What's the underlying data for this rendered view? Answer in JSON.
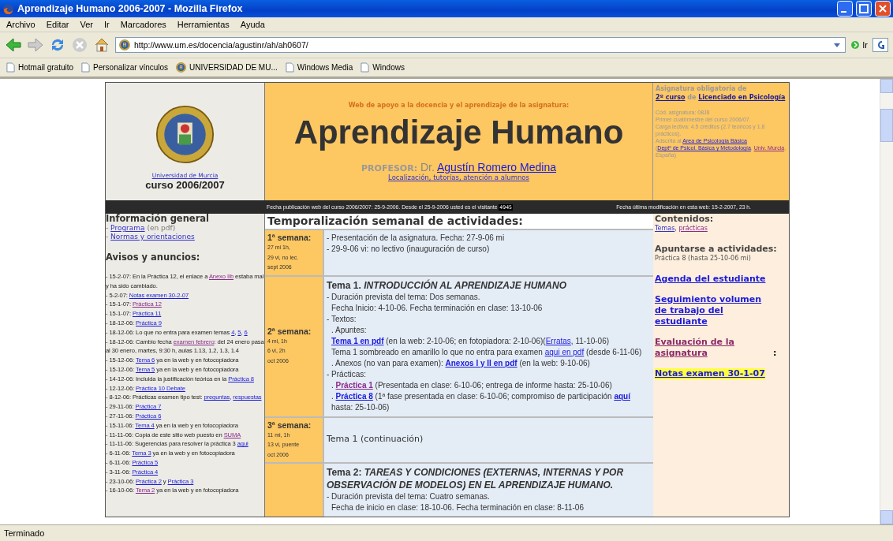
{
  "window": {
    "title": "Aprendizaje Humano 2006-2007 - Mozilla Firefox"
  },
  "menu": [
    "Archivo",
    "Editar",
    "Ver",
    "Ir",
    "Marcadores",
    "Herramientas",
    "Ayuda"
  ],
  "toolbar": {
    "url": "http://www.um.es/docencia/agustinr/ah/ah0607/",
    "go": "Ir"
  },
  "bookmarks": [
    {
      "label": "Hotmail gratuito",
      "kind": "page"
    },
    {
      "label": "Personalizar vínculos",
      "kind": "page"
    },
    {
      "label": "UNIVERSIDAD DE MU...",
      "kind": "seal"
    },
    {
      "label": "Windows Media",
      "kind": "page"
    },
    {
      "label": "Windows",
      "kind": "page"
    }
  ],
  "header": {
    "university_link": "Universidad de Murcia",
    "course": "curso 2006/2007",
    "tagline": "Web de apoyo a la docencia y el aprendizaje de la asignatura:",
    "title": "Aprendizaje Humano",
    "professor": [
      {
        "text": "PROFESOR:",
        "kind": "label"
      },
      {
        "text": " Dr. ",
        "kind": "text"
      },
      {
        "text": "Agustín Romero Medina",
        "kind": "link"
      }
    ],
    "contact_link": "Localización, tutorías, atención a alumnos",
    "subject_lines": [
      [
        {
          "text": "Asignatura obligatoria de",
          "kind": "text"
        }
      ],
      [
        {
          "text": "2º curso",
          "kind": "link"
        },
        {
          "text": " de ",
          "kind": "text"
        },
        {
          "text": "Licenciado en Psicología",
          "kind": "link"
        }
      ]
    ],
    "details": [
      [
        {
          "text": "Cód. asignatura: 08J8",
          "kind": "text"
        }
      ],
      [
        {
          "text": "Primer cuatrimestre del curso 2006/07.",
          "kind": "text"
        }
      ],
      [
        {
          "text": "Carga lectiva: 4.5 créditos (2.7 teóricos y 1.8 prácticos).",
          "kind": "text"
        }
      ],
      [
        {
          "text": "Adscrita al ",
          "kind": "text"
        },
        {
          "text": "Area de Psicología Básica",
          "kind": "link"
        }
      ],
      [
        {
          "text": "(",
          "kind": "text"
        },
        {
          "text": "Deptº de Psicol. Básica y Metodología",
          "kind": "link"
        },
        {
          "text": ", ",
          "kind": "text"
        },
        {
          "text": "Univ. Murcia",
          "kind": "visited"
        },
        {
          "text": ", España)",
          "kind": "text"
        }
      ]
    ]
  },
  "info_bar": {
    "left": [
      {
        "text": "Fecha publicación web del curso 2006/2007: 25-9-2006. Desde el 25-9-2006 usted es el visitante ",
        "kind": "text"
      },
      {
        "text": "4945",
        "kind": "counter"
      }
    ],
    "right": "Fecha última modificación en esta web: 15-2-2007, 23 h."
  },
  "left": {
    "heading": "Información general",
    "links": [
      [
        {
          "text": "- ",
          "kind": "text"
        },
        {
          "text": "Programa",
          "kind": "link"
        },
        {
          "text": " (en pdf)",
          "kind": "text"
        }
      ],
      [
        {
          "text": "- ",
          "kind": "text"
        },
        {
          "text": "Normas y orientaciones",
          "kind": "link"
        }
      ]
    ],
    "news_heading": "Avisos y anuncios:",
    "news": [
      [
        {
          "text": "- 15-2-07: En la Práctica 12, el enlace a ",
          "kind": "text"
        },
        {
          "text": "Anexo IIb",
          "kind": "visited"
        },
        {
          "text": " estaba mal y ha sido cambiado.",
          "kind": "text"
        }
      ],
      [
        {
          "text": "- 5-2-07: ",
          "kind": "text"
        },
        {
          "text": "Notas examen 30-2-07",
          "kind": "link"
        }
      ],
      [
        {
          "text": "- 15-1-07: ",
          "kind": "text"
        },
        {
          "text": "Práctica 12",
          "kind": "visited"
        }
      ],
      [
        {
          "text": "- 15-1-07: ",
          "kind": "text"
        },
        {
          "text": "Práctica 11",
          "kind": "link"
        }
      ],
      [
        {
          "text": "- 18-12-06: ",
          "kind": "text"
        },
        {
          "text": "Práctica 9",
          "kind": "link"
        }
      ],
      [
        {
          "text": "- 18-12-06: Lo que no entra para examen temas ",
          "kind": "text"
        },
        {
          "text": "4",
          "kind": "link"
        },
        {
          "text": ", ",
          "kind": "text"
        },
        {
          "text": "5",
          "kind": "link"
        },
        {
          "text": ", ",
          "kind": "text"
        },
        {
          "text": "6",
          "kind": "link"
        }
      ],
      [
        {
          "text": "- 18-12-06: Cambio fecha ",
          "kind": "text"
        },
        {
          "text": "examen febrero",
          "kind": "visited"
        },
        {
          "text": ": del 24 enero pasa al 30 enero, martes, 9:30 h, aulas 1.13, 1.2, 1.3, 1.4",
          "kind": "text"
        }
      ],
      [
        {
          "text": "- 15-12-06: ",
          "kind": "text"
        },
        {
          "text": "Tema 6",
          "kind": "link"
        },
        {
          "text": " ya en la web y en fotocopiadora",
          "kind": "text"
        }
      ],
      [
        {
          "text": "- 15-12-06: ",
          "kind": "text"
        },
        {
          "text": "Tema 5",
          "kind": "link"
        },
        {
          "text": " ya en la web y en fotocopiadora",
          "kind": "text"
        }
      ],
      [
        {
          "text": "- 14-12-06: Incluida la justificación teórica en la ",
          "kind": "text"
        },
        {
          "text": "Práctica 8",
          "kind": "link"
        }
      ],
      [
        {
          "text": "- 12-12-06: ",
          "kind": "text"
        },
        {
          "text": "Práctica 10 Debate",
          "kind": "link"
        }
      ],
      [
        {
          "text": "- 8-12-06: Prácticas examen tipo test: ",
          "kind": "text"
        },
        {
          "text": "preguntas",
          "kind": "link"
        },
        {
          "text": ", ",
          "kind": "text"
        },
        {
          "text": "respuestas",
          "kind": "link"
        }
      ],
      [
        {
          "text": "- 29-11-06: ",
          "kind": "text"
        },
        {
          "text": "Práctica 7",
          "kind": "link"
        }
      ],
      [
        {
          "text": "- 27-11-06: ",
          "kind": "text"
        },
        {
          "text": "Práctica 6",
          "kind": "link"
        }
      ],
      [
        {
          "text": "- 15-11-06: ",
          "kind": "text"
        },
        {
          "text": "Tema 4",
          "kind": "link"
        },
        {
          "text": " ya en la web y en fotocopiadora",
          "kind": "text"
        }
      ],
      [
        {
          "text": "- 11-11-06: Copia de este sitio web puesto en ",
          "kind": "text"
        },
        {
          "text": "SUMA",
          "kind": "visited"
        }
      ],
      [
        {
          "text": "- 11-11-06: Sugerencias para resolver la práctica 3 ",
          "kind": "text"
        },
        {
          "text": "aqui",
          "kind": "link"
        }
      ],
      [
        {
          "text": "- 6-11-06: ",
          "kind": "text"
        },
        {
          "text": "Tema 3",
          "kind": "link"
        },
        {
          "text": " ya en la web y en fotocopiadora",
          "kind": "text"
        }
      ],
      [
        {
          "text": "- 6-11-06: ",
          "kind": "text"
        },
        {
          "text": "Práctica 5",
          "kind": "link"
        }
      ],
      [
        {
          "text": "- 3-11-06: ",
          "kind": "text"
        },
        {
          "text": "Práctica 4",
          "kind": "link"
        }
      ],
      [
        {
          "text": "- 23-10-06: ",
          "kind": "text"
        },
        {
          "text": "Práctica 2",
          "kind": "link"
        },
        {
          "text": " y ",
          "kind": "text"
        },
        {
          "text": "Práctica 3",
          "kind": "link"
        }
      ],
      [
        {
          "text": "- 16-10-06: ",
          "kind": "text"
        },
        {
          "text": "Tema 2",
          "kind": "visited"
        },
        {
          "text": " ya en la web y en fotocopiadora",
          "kind": "text"
        }
      ]
    ]
  },
  "schedule": {
    "heading": "Temporalización semanal de actividades:",
    "weeks": [
      {
        "label": "1ª semana:",
        "notes": [
          "27 mi 1h,",
          "29 vi, no lec.",
          "sept 2006"
        ],
        "lines": [
          {
            "kind": "line",
            "indent": false,
            "parts": [
              {
                "text": "- Presentación de la asignatura. Fecha: 27-9-06 mi",
                "kind": "text"
              }
            ]
          },
          {
            "kind": "line",
            "indent": false,
            "parts": [
              {
                "text": "- 29-9-06 vi: no lectivo (inauguración de curso)",
                "kind": "text"
              }
            ]
          }
        ]
      },
      {
        "label": "2ª semana:",
        "notes": [
          "4 mi, 1h",
          "6 vi, 2h",
          "oct 2006"
        ],
        "lines": [
          {
            "kind": "title",
            "text": "Tema 1. *INTRODUCCIÓN AL APRENDIZAJE HUMANO*"
          },
          {
            "kind": "line",
            "indent": false,
            "parts": [
              {
                "text": "- Duración prevista del tema: Dos semanas.",
                "kind": "text"
              }
            ]
          },
          {
            "kind": "line",
            "indent": true,
            "parts": [
              {
                "text": "Fecha Inicio: 4-10-06. Fecha terminación en clase: 13-10-06",
                "kind": "text"
              }
            ]
          },
          {
            "kind": "line",
            "indent": false,
            "parts": [
              {
                "text": "- Textos:",
                "kind": "text"
              }
            ]
          },
          {
            "kind": "line",
            "indent": true,
            "parts": [
              {
                "text": ". Apuntes:",
                "kind": "text"
              }
            ]
          },
          {
            "kind": "line",
            "indent": true,
            "parts": [
              {
                "text": "Tema 1 en pdf",
                "kind": "strong"
              },
              {
                "text": " (en la web: 2-10-06; en fotopiadora: 2-10-06)(",
                "kind": "text"
              },
              {
                "text": "Erratas",
                "kind": "link"
              },
              {
                "text": ", 11-10-06)",
                "kind": "text"
              }
            ]
          },
          {
            "kind": "line",
            "indent": true,
            "parts": [
              {
                "text": "Tema 1 sombreado en amarillo lo que no entra para examen ",
                "kind": "text"
              },
              {
                "text": "aqui en pdf",
                "kind": "link"
              },
              {
                "text": " (desde 6-11-06)",
                "kind": "text"
              }
            ]
          },
          {
            "kind": "line",
            "indent": true,
            "parts": [
              {
                "text": ". Anexos (no van para examen): ",
                "kind": "text"
              },
              {
                "text": "Anexos I y II en pdf",
                "kind": "strong"
              },
              {
                "text": " (en la web: 9-10-06)",
                "kind": "text"
              }
            ]
          },
          {
            "kind": "line",
            "indent": false,
            "parts": [
              {
                "text": "- Prácticas:",
                "kind": "text"
              }
            ]
          },
          {
            "kind": "line",
            "indent": true,
            "parts": [
              {
                "text": ". ",
                "kind": "text"
              },
              {
                "text": "Práctica 1",
                "kind": "strong-visited"
              },
              {
                "text": " (Presentada en clase: 6-10-06; entrega de informe hasta: 25-10-06)",
                "kind": "text"
              }
            ]
          },
          {
            "kind": "line",
            "indent": true,
            "parts": [
              {
                "text": ". ",
                "kind": "text"
              },
              {
                "text": "Práctica 8",
                "kind": "strong"
              },
              {
                "text": " (1ª fase presentada en clase: 6-10-06; compromiso de participación ",
                "kind": "text"
              },
              {
                "text": "aquí",
                "kind": "strong"
              },
              {
                "text": " hasta: 25-10-06)",
                "kind": "text"
              }
            ]
          }
        ]
      },
      {
        "label": "3ª semana:",
        "notes": [
          "11 mi, 1h",
          "13 vi, puente",
          "oct 2006"
        ],
        "lines": [
          {
            "kind": "large",
            "text": "Tema 1 (continuación)"
          }
        ]
      },
      {
        "lines": [
          {
            "kind": "title",
            "text": "Tema 2: *TAREAS Y CONDICIONES (EXTERNAS, INTERNAS Y POR OBSERVACIÓN DE MODELOS) EN EL APRENDIZAJE HUMANO.*"
          },
          {
            "kind": "line",
            "indent": false,
            "parts": [
              {
                "text": "- Duración prevista del tema: Cuatro semanas.",
                "kind": "text"
              }
            ]
          },
          {
            "kind": "line",
            "indent": true,
            "parts": [
              {
                "text": "Fecha de inicio en clase: 18-10-06.  Fecha terminación en clase: 8-11-06",
                "kind": "text"
              }
            ]
          }
        ]
      }
    ]
  },
  "right": [
    {
      "kind": "heading",
      "parts": [
        {
          "text": "Contenidos:",
          "kind": "text"
        }
      ]
    },
    {
      "kind": "small",
      "parts": [
        {
          "text": "Temas",
          "kind": "link"
        },
        {
          "text": ", ",
          "kind": "text"
        },
        {
          "text": "prácticas",
          "kind": "visited"
        }
      ]
    },
    {
      "kind": "heading",
      "parts": [
        {
          "text": "Apuntarse a actividades:",
          "kind": "text"
        }
      ]
    },
    {
      "kind": "small",
      "parts": [
        {
          "text": "Práctica 8 (hasta 25-10-06 mi)",
          "kind": "text"
        }
      ]
    },
    {
      "kind": "big",
      "parts": [
        {
          "text": "Agenda del estudiante",
          "kind": "link"
        }
      ]
    },
    {
      "kind": "big",
      "parts": [
        {
          "text": "Seguimiento volumen de trabajo del estudiante",
          "kind": "link"
        }
      ]
    },
    {
      "kind": "big",
      "parts": [
        {
          "text": "Evaluación de la asignatura",
          "kind": "visited"
        },
        {
          "text": ":",
          "kind": "text"
        }
      ]
    },
    {
      "kind": "highlight",
      "parts": [
        {
          "text": "Notas examen 30-1-07",
          "kind": "link"
        }
      ]
    }
  ],
  "status_bar": "Terminado"
}
